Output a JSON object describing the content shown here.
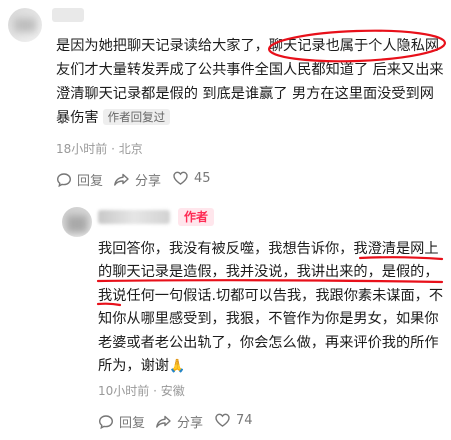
{
  "comment": {
    "text": "是因为她把聊天记录读给大家了，聊天记录也属于个人隐私网友们才大量转发弄成了公共事件全国人民都知道了 后来又出来澄清聊天记录都是假的  到底是谁赢了 男方在这里面没受到网暴伤害",
    "author_replied_tag": "作者回复过",
    "time_location": "18小时前 · 北京",
    "reply_label": "回复",
    "share_label": "分享",
    "like_count": "45"
  },
  "reply": {
    "author_tag": "作者",
    "text": "我回答你，我没有被反噬，我想告诉你，我澄清是网上的聊天记录是造假，我并没说，我讲出来的，是假的，我说任何一句假话.切都可以告我，我跟你素未谋面，不知你从哪里感受到，我狠，不管作为你是男女，如果你老婆或者老公出轨了，你会怎么做，再来评价我的所作所为，谢谢",
    "emoji": "🙏",
    "time_location": "10小时前 · 安徽",
    "reply_label": "回复",
    "share_label": "分享",
    "like_count": "74"
  },
  "icons": [
    "comment-icon",
    "share-icon",
    "heart-icon"
  ],
  "colors": {
    "annotation_red": "#e8101a",
    "author_tag_text": "#fe2c55",
    "author_tag_bg": "#ffe6ec"
  }
}
